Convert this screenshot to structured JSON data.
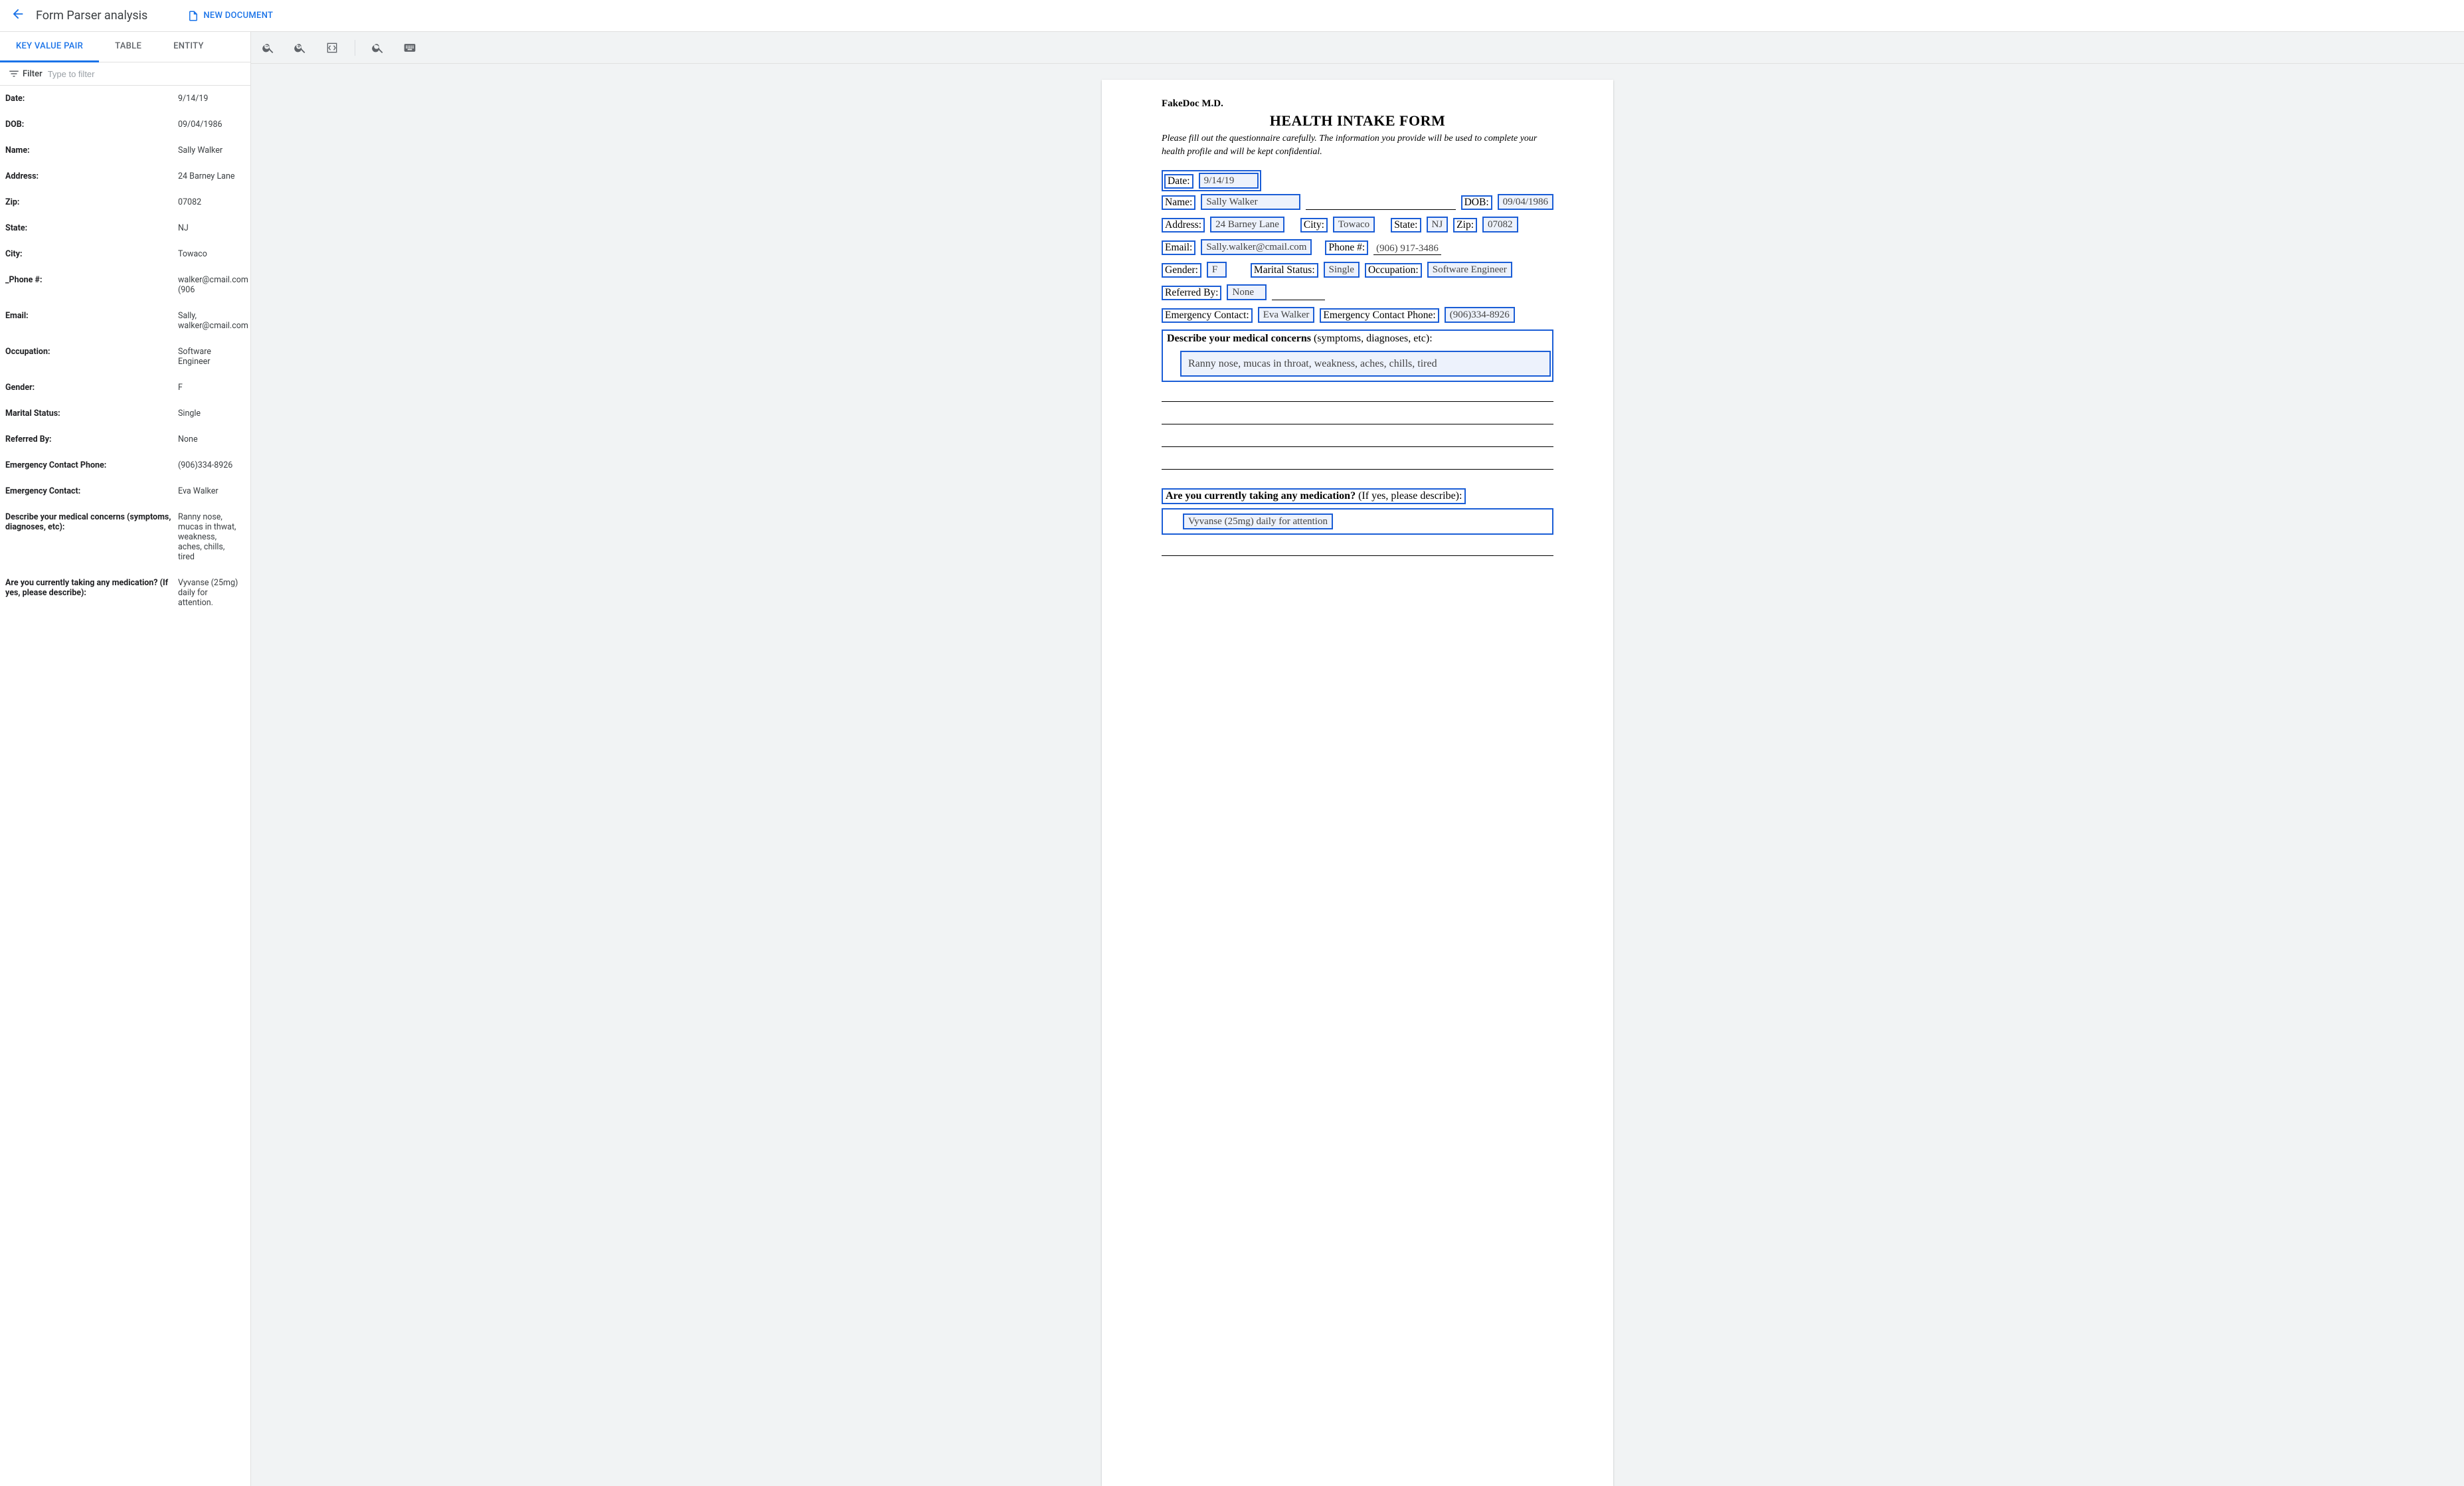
{
  "header": {
    "title": "Form Parser analysis",
    "new_document": "NEW DOCUMENT"
  },
  "tabs": {
    "kv": "KEY VALUE PAIR",
    "table": "TABLE",
    "entity": "ENTITY"
  },
  "filter": {
    "label": "Filter",
    "placeholder": "Type to filter"
  },
  "kv_pairs": [
    {
      "key": "Date:",
      "value": "9/14/19"
    },
    {
      "key": "DOB:",
      "value": "09/04/1986"
    },
    {
      "key": "Name:",
      "value": "Sally Walker"
    },
    {
      "key": "Address:",
      "value": "24 Barney Lane"
    },
    {
      "key": "Zip:",
      "value": "07082"
    },
    {
      "key": "State:",
      "value": "NJ"
    },
    {
      "key": "City:",
      "value": "Towaco"
    },
    {
      "key": "_Phone #:",
      "value": "walker@cmail.com (906"
    },
    {
      "key": "Email:",
      "value": "Sally, walker@cmail.com"
    },
    {
      "key": "Occupation:",
      "value": "Software Engineer"
    },
    {
      "key": "Gender:",
      "value": "F"
    },
    {
      "key": "Marital Status:",
      "value": "Single"
    },
    {
      "key": "Referred By:",
      "value": "None"
    },
    {
      "key": "Emergency Contact Phone:",
      "value": "(906)334-8926"
    },
    {
      "key": "Emergency Contact:",
      "value": "Eva Walker"
    },
    {
      "key": "Describe your medical concerns (symptoms, diagnoses, etc):",
      "value": "Ranny nose, mucas in thwat, weakness, aches, chills, tired"
    },
    {
      "key": "Are you currently taking any medication? (If yes, please describe):",
      "value": "Vyvanse (25mg) daily for attention."
    }
  ],
  "doc": {
    "doctor": "FakeDoc M.D.",
    "title": "HEALTH INTAKE FORM",
    "intro": "Please fill out the questionnaire carefully. The information you provide will be used to complete your health profile and will be kept confidential.",
    "fields": {
      "date_l": "Date:",
      "date_v": "9/14/19",
      "name_l": "Name:",
      "name_v": "Sally Walker",
      "dob_l": "DOB:",
      "dob_v": "09/04/1986",
      "addr_l": "Address:",
      "addr_v": "24 Barney Lane",
      "city_l": "City:",
      "city_v": "Towaco",
      "state_l": "State:",
      "state_v": "NJ",
      "zip_l": "Zip:",
      "zip_v": "07082",
      "email_l": "Email:",
      "email_v": "Sally.walker@cmail.com",
      "phone_l": "Phone #:",
      "phone_v": "(906) 917-3486",
      "gender_l": "Gender:",
      "gender_v": "F",
      "marital_l": "Marital Status:",
      "marital_v": "Single",
      "occ_l": "Occupation:",
      "occ_v": "Software Engineer",
      "ref_l": "Referred By:",
      "ref_v": "None",
      "ec_l": "Emergency Contact:",
      "ec_v": "Eva Walker",
      "ecp_l": "Emergency Contact Phone:",
      "ecp_v": "(906)334-8926",
      "concerns_l_b": "Describe your medical concerns",
      "concerns_l_r": " (symptoms, diagnoses, etc):",
      "concerns_v": "Ranny nose, mucas in throat, weakness, aches, chills, tired",
      "meds_l_b": "Are you currently taking any medication?",
      "meds_l_r": " (If yes, please describe):",
      "meds_v": "Vyvanse (25mg) daily for attention"
    }
  }
}
